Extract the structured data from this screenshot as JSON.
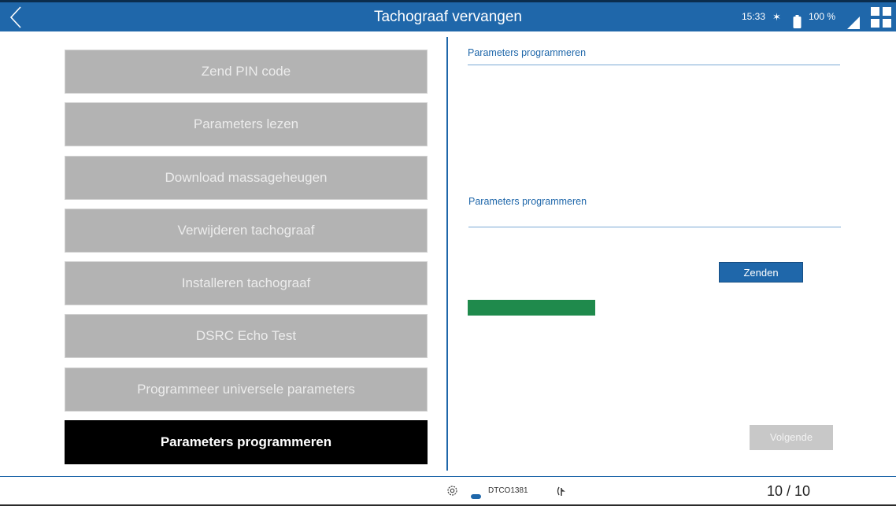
{
  "header": {
    "title": "Tachograaf vervangen",
    "back_icon": "chevron-left-icon",
    "time": "15:33",
    "bluetooth_glyph": "✶",
    "bluetooth_icon": "bluetooth-icon",
    "battery_icon": "battery-icon",
    "battery": "100 %",
    "signal_icon": "signal-icon",
    "menu_icon": "grid-icon"
  },
  "steps": [
    {
      "label": "Zend PIN code",
      "active": false
    },
    {
      "label": "Parameters lezen",
      "active": false
    },
    {
      "label": "Download massageheugen",
      "active": false
    },
    {
      "label": "Verwijderen tachograaf",
      "active": false
    },
    {
      "label": "Installeren tachograaf",
      "active": false
    },
    {
      "label": "DSRC Echo Test",
      "active": false
    },
    {
      "label": "Programmeer universele parameters",
      "active": false
    },
    {
      "label": "Parameters programmeren",
      "active": true
    }
  ],
  "panel": {
    "section1_title": "Parameters programmeren",
    "section2_title": "Parameters programmeren",
    "send_label": "Zenden",
    "progress": 0.34,
    "next_label": "Volgende"
  },
  "footer": {
    "settings_icon": "settings-icon",
    "device_icon": "device-icon",
    "device": "DTCO1381",
    "connection_icon": "connection-icon",
    "page": "10 / 10"
  },
  "colors": {
    "header_bg": "#1f67aa",
    "step_inactive_bg": "#b3b3b3",
    "step_active_bg": "#000000",
    "progress_fill": "#1f8a4c",
    "accent": "#1f67aa"
  }
}
